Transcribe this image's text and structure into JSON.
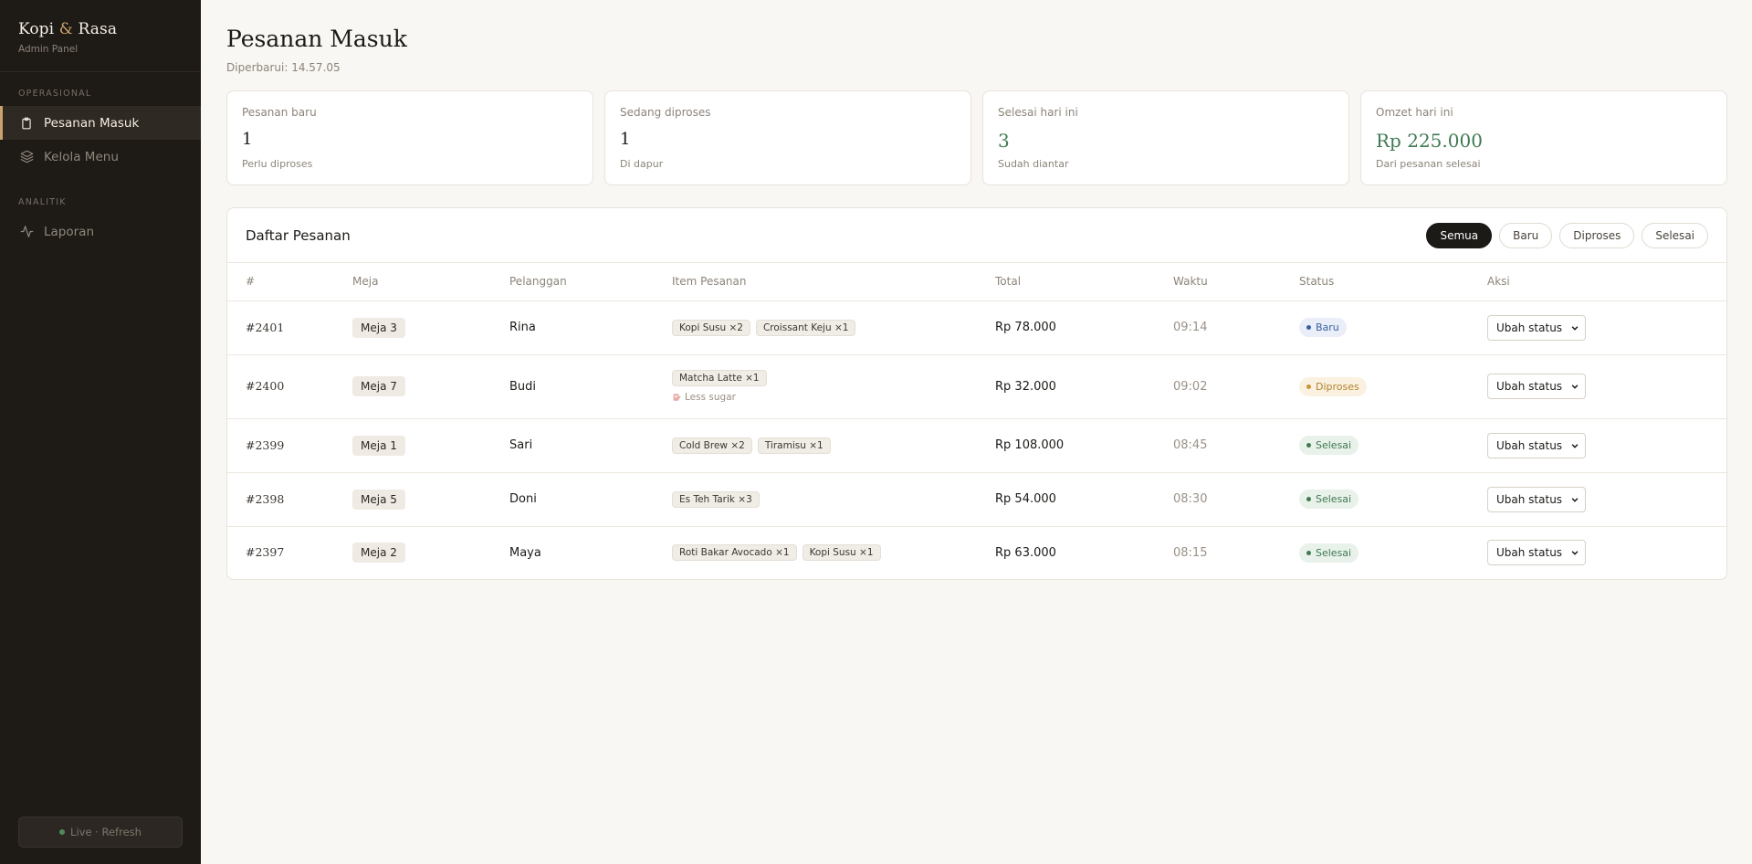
{
  "brand": {
    "title_a": "Kopi",
    "amp": "&",
    "title_b": "Rasa",
    "subtitle": "Admin Panel"
  },
  "sidebar": {
    "section_ops": "OPERASIONAL",
    "section_analytics": "ANALITIK",
    "items": [
      {
        "label": "Pesanan Masuk",
        "icon": "clipboard-icon"
      },
      {
        "label": "Kelola Menu",
        "icon": "layers-icon"
      },
      {
        "label": "Laporan",
        "icon": "activity-icon"
      }
    ],
    "live_label": "Live · Refresh"
  },
  "header": {
    "title": "Pesanan Masuk",
    "updated": "Diperbarui: 14.57.05"
  },
  "stats": [
    {
      "label": "Pesanan baru",
      "value": "1",
      "sub": "Perlu diproses"
    },
    {
      "label": "Sedang diproses",
      "value": "1",
      "sub": "Di dapur"
    },
    {
      "label": "Selesai hari ini",
      "value": "3",
      "sub": "Sudah diantar"
    },
    {
      "label": "Omzet hari ini",
      "value": "Rp 225.000",
      "sub": "Dari pesanan selesai"
    }
  ],
  "orders": {
    "title": "Daftar Pesanan",
    "filters": [
      "Semua",
      "Baru",
      "Diproses",
      "Selesai"
    ],
    "columns": [
      "#",
      "Meja",
      "Pelanggan",
      "Item Pesanan",
      "Total",
      "Waktu",
      "Status",
      "Aksi"
    ],
    "action_label": "Ubah status",
    "rows": [
      {
        "id": "#2401",
        "meja": "Meja 3",
        "pelanggan": "Rina",
        "items": [
          "Kopi Susu ×2",
          "Croissant Keju ×1"
        ],
        "note": "",
        "total": "Rp 78.000",
        "waktu": "09:14",
        "status": "Baru"
      },
      {
        "id": "#2400",
        "meja": "Meja 7",
        "pelanggan": "Budi",
        "items": [
          "Matcha Latte ×1"
        ],
        "note": "Less sugar",
        "total": "Rp 32.000",
        "waktu": "09:02",
        "status": "Diproses"
      },
      {
        "id": "#2399",
        "meja": "Meja 1",
        "pelanggan": "Sari",
        "items": [
          "Cold Brew ×2",
          "Tiramisu ×1"
        ],
        "note": "",
        "total": "Rp 108.000",
        "waktu": "08:45",
        "status": "Selesai"
      },
      {
        "id": "#2398",
        "meja": "Meja 5",
        "pelanggan": "Doni",
        "items": [
          "Es Teh Tarik ×3"
        ],
        "note": "",
        "total": "Rp 54.000",
        "waktu": "08:30",
        "status": "Selesai"
      },
      {
        "id": "#2397",
        "meja": "Meja 2",
        "pelanggan": "Maya",
        "items": [
          "Roti Bakar Avocado ×1",
          "Kopi Susu ×1"
        ],
        "note": "",
        "total": "Rp 63.000",
        "waktu": "08:15",
        "status": "Selesai"
      }
    ]
  },
  "colors": {
    "sidebar_bg": "#1e1a16",
    "accent": "#c9a36b",
    "success": "#3f7a52",
    "info": "#3a5f9e",
    "warning": "#c99532"
  }
}
